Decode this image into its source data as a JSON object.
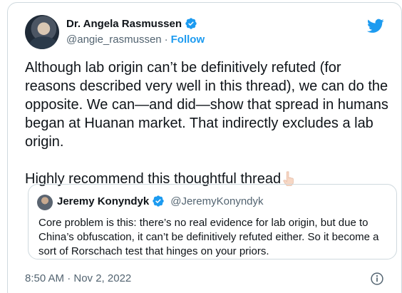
{
  "author": {
    "name": "Dr. Angela Rasmussen",
    "handle": "@angie_rasmussen",
    "separator": "·",
    "follow_label": "Follow"
  },
  "tweet": {
    "text": "Although lab origin can’t be definitively refuted (for reasons described very well in this thread), we can do the opposite. We can—and did—show that  spread in humans began at Huanan market. That indirectly excludes a lab origin.\n\nHighly recommend this thoughtful thread",
    "emoji_icon": "backhand-index-pointing-down-icon"
  },
  "quoted": {
    "name": "Jeremy Konyndyk",
    "handle": "@JeremyKonyndyk",
    "text": "Core problem is this: there’s no real evidence for lab origin, but due to China’s obfuscation, it can’t be definitively refuted either. So it become a sort of Rorschach test that hinges on your priors."
  },
  "meta": {
    "timestamp": "8:50 AM · Nov 2, 2022"
  },
  "colors": {
    "accent": "#1d9bf0",
    "text": "#0f1419",
    "secondary": "#536471",
    "border": "#cfd9de"
  }
}
